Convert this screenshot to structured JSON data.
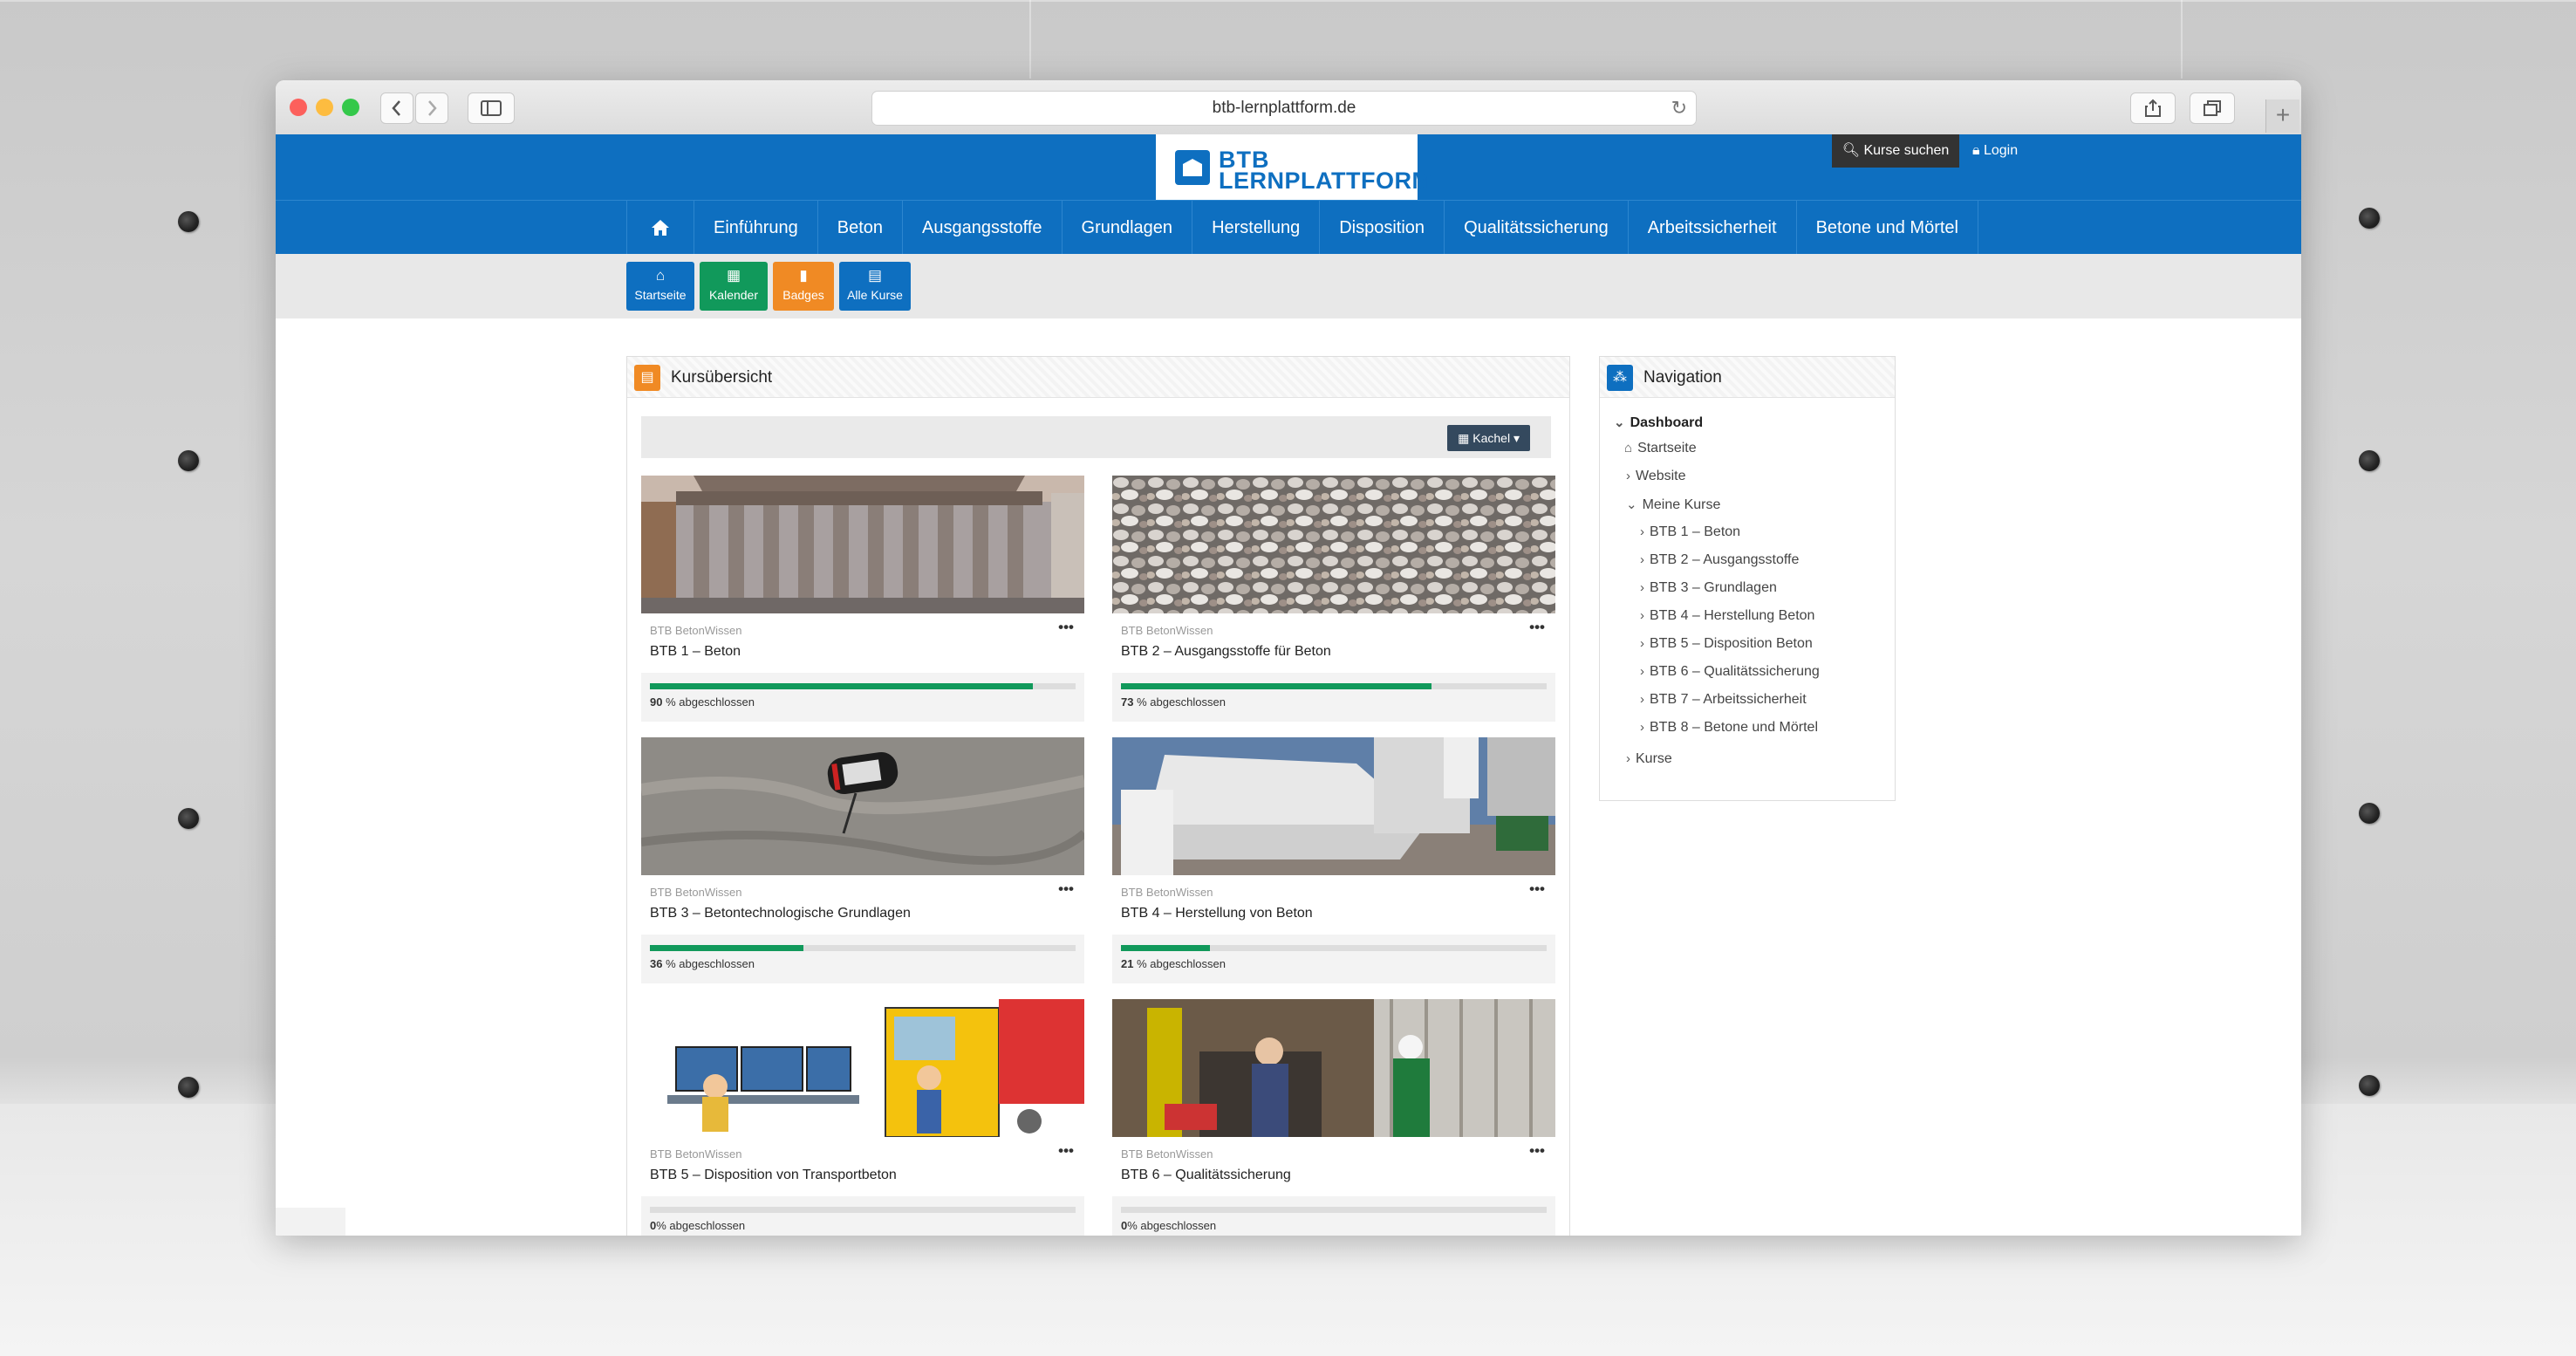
{
  "browser": {
    "url": "btb-lernplattform.de",
    "back_icon": "chevron-left-icon",
    "forward_icon": "chevron-right-icon",
    "sidebar_icon": "sidebar-icon",
    "reload_icon": "reload-icon",
    "share_icon": "share-icon",
    "tabs_icon": "tabs-icon",
    "new_tab_label": "+"
  },
  "header": {
    "logo_line1": "BTB",
    "logo_line2": "LERNPLATTFORM",
    "search_label": "Kurse suchen",
    "login_label": "Login",
    "brand_color": "#0e6fc0"
  },
  "nav": {
    "home_icon": "home-icon",
    "items": [
      "Einführung",
      "Beton",
      "Ausgangsstoffe",
      "Grundlagen",
      "Herstellung",
      "Disposition",
      "Qualitätssicherung",
      "Arbeitssicherheit",
      "Betone und Mörtel"
    ]
  },
  "quicklinks": [
    {
      "label": "Startseite",
      "icon": "home-icon",
      "color": "#0e6fc0"
    },
    {
      "label": "Kalender",
      "icon": "calendar-icon",
      "color": "#11995b"
    },
    {
      "label": "Badges",
      "icon": "bookmark-icon",
      "color": "#f08a24"
    },
    {
      "label": "Alle Kurse",
      "icon": "book-icon",
      "color": "#0e6fc0"
    }
  ],
  "main": {
    "title": "Kursübersicht",
    "view_button": "Kachel",
    "courses": [
      {
        "category": "BTB BetonWissen",
        "title": "BTB 1 – Beton",
        "progress": 90,
        "progress_label": "% abgeschlossen",
        "image": "pantheon-columns-photo"
      },
      {
        "category": "BTB BetonWissen",
        "title": "BTB 2 – Ausgangsstoffe für Beton",
        "progress": 73,
        "progress_label": "% abgeschlossen",
        "image": "gravel-photo"
      },
      {
        "category": "BTB BetonWissen",
        "title": "BTB 3 – Betontechnologische Grundlagen",
        "progress": 36,
        "progress_label": "% abgeschlossen",
        "image": "concrete-thermometer-photo"
      },
      {
        "category": "BTB BetonWissen",
        "title": "BTB 4 – Herstellung von Beton",
        "progress": 21,
        "progress_label": "% abgeschlossen",
        "image": "concrete-plant-photo"
      },
      {
        "category": "BTB BetonWissen",
        "title": "BTB 5 – Disposition von Transportbeton",
        "progress": 0,
        "progress_label": "% abgeschlossen",
        "image": "dispatcher-truck-illustration"
      },
      {
        "category": "BTB BetonWissen",
        "title": "BTB 6 – Qualitätssicherung",
        "progress": 0,
        "progress_label": "% abgeschlossen",
        "image": "workers-testing-photo"
      }
    ]
  },
  "sidebar": {
    "title": "Navigation",
    "dashboard": "Dashboard",
    "startseite": "Startseite",
    "website": "Website",
    "meine_kurse": "Meine Kurse",
    "my_courses": [
      "BTB 1 – Beton",
      "BTB 2 – Ausgangsstoffe",
      "BTB 3 – Grundlagen",
      "BTB 4 – Herstellung Beton",
      "BTB 5 – Disposition Beton",
      "BTB 6 – Qualitätssicherung",
      "BTB 7 – Arbeitssicherheit",
      "BTB 8 – Betone und Mörtel"
    ],
    "kurse": "Kurse"
  }
}
